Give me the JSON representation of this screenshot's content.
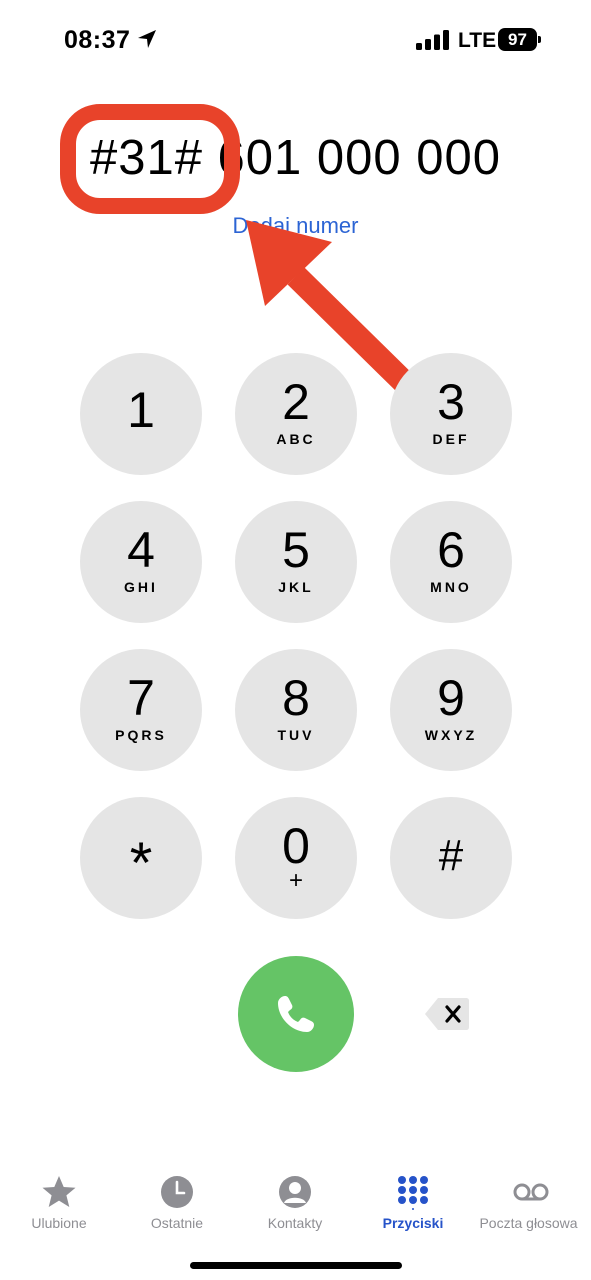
{
  "status_bar": {
    "time": "08:37",
    "network": "LTE",
    "battery_level": "97",
    "icons": [
      "location-arrow-icon",
      "cellular-signal-icon",
      "battery-icon"
    ]
  },
  "dialer": {
    "number": "#31# 601 000 000",
    "add_number_link": "Dodaj numer"
  },
  "annotation": {
    "color": "#e8432a",
    "shapes": [
      "highlight-rounded-rectangle",
      "pointer-arrow"
    ]
  },
  "keypad": [
    {
      "digit": "1",
      "letters": ""
    },
    {
      "digit": "2",
      "letters": "ABC"
    },
    {
      "digit": "3",
      "letters": "DEF"
    },
    {
      "digit": "4",
      "letters": "GHI"
    },
    {
      "digit": "5",
      "letters": "JKL"
    },
    {
      "digit": "6",
      "letters": "MNO"
    },
    {
      "digit": "7",
      "letters": "PQRS"
    },
    {
      "digit": "8",
      "letters": "TUV"
    },
    {
      "digit": "9",
      "letters": "WXYZ"
    },
    {
      "digit": "*",
      "letters": ""
    },
    {
      "digit": "0",
      "letters": "+"
    },
    {
      "digit": "#",
      "letters": ""
    }
  ],
  "actions": {
    "call_icon": "phone-icon",
    "delete_icon": "backspace-icon",
    "call_color": "#65c466"
  },
  "tab_bar": {
    "active_color": "#2653c9",
    "tabs": [
      {
        "label": "Ulubione",
        "icon": "star-icon"
      },
      {
        "label": "Ostatnie",
        "icon": "clock-icon"
      },
      {
        "label": "Kontakty",
        "icon": "person-icon"
      },
      {
        "label": "Przyciski",
        "icon": "keypad-icon",
        "active": true
      },
      {
        "label": "Poczta głosowa",
        "icon": "voicemail-icon"
      }
    ]
  }
}
